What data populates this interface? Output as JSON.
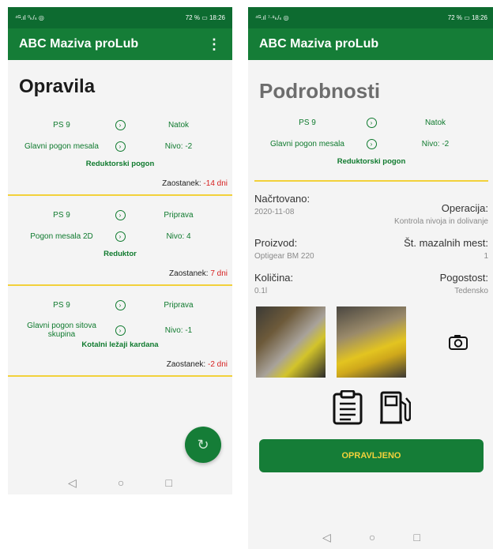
{
  "left": {
    "status_left": "⁴ᴳ.ıl ⁰ₖ/ₛ ◎",
    "status_right": "72 % ▭ 18:26",
    "app_title": "ABC Maziva proLub",
    "more_icon": "⋮",
    "screen_title": "Opravila",
    "tasks": [
      {
        "machine": "PS 9",
        "action": "Natok",
        "part": "Glavni pogon mesala",
        "level": "Nivo: -2",
        "component": "Reduktorski pogon",
        "overdue_label": "Zaostanek: ",
        "overdue_value": "-14 dni"
      },
      {
        "machine": "PS 9",
        "action": "Priprava",
        "part": "Pogon mesala 2D",
        "level": "Nivo: 4",
        "component": "Reduktor",
        "overdue_label": "Zaostanek: ",
        "overdue_value": "7 dni"
      },
      {
        "machine": "PS 9",
        "action": "Priprava",
        "part": "Glavni pogon sitova skupina",
        "level": "Nivo: -1",
        "component": "Kotalni ležaji kardana",
        "overdue_label": "Zaostanek: ",
        "overdue_value": "-2 dni"
      }
    ],
    "fab_icon": "↻",
    "nav": {
      "back": "◁",
      "home": "○",
      "recent": "□"
    }
  },
  "right": {
    "status_left": "⁴ᴳ.ıl ⁷·⁸ₖ/ₛ ◎",
    "status_right": "72 % ▭ 18:26",
    "app_title": "ABC Maziva proLub",
    "screen_title": "Podrobnosti",
    "machine": "PS 9",
    "action": "Natok",
    "part": "Glavni pogon mesala",
    "level": "Nivo: -2",
    "component": "Reduktorski pogon",
    "planned_label": "Načrtovano:",
    "planned_value": "2020-11-08",
    "operation_label": "Operacija:",
    "operation_value": "Kontrola nivoja in dolivanje",
    "product_label": "Proizvod:",
    "product_value": "Optigear BM 220",
    "points_label": "Št. mazalnih mest:",
    "points_value": "1",
    "quantity_label": "Količina:",
    "quantity_value": "0.1l",
    "frequency_label": "Pogostost:",
    "frequency_value": "Tedensko",
    "done_label": "OPRAVLJENO",
    "nav": {
      "back": "◁",
      "home": "○",
      "recent": "□"
    }
  },
  "colors": {
    "primary": "#157d37",
    "statusbar": "#0d6b30",
    "accent": "#f2d13b",
    "overdue": "#d61f1f"
  }
}
